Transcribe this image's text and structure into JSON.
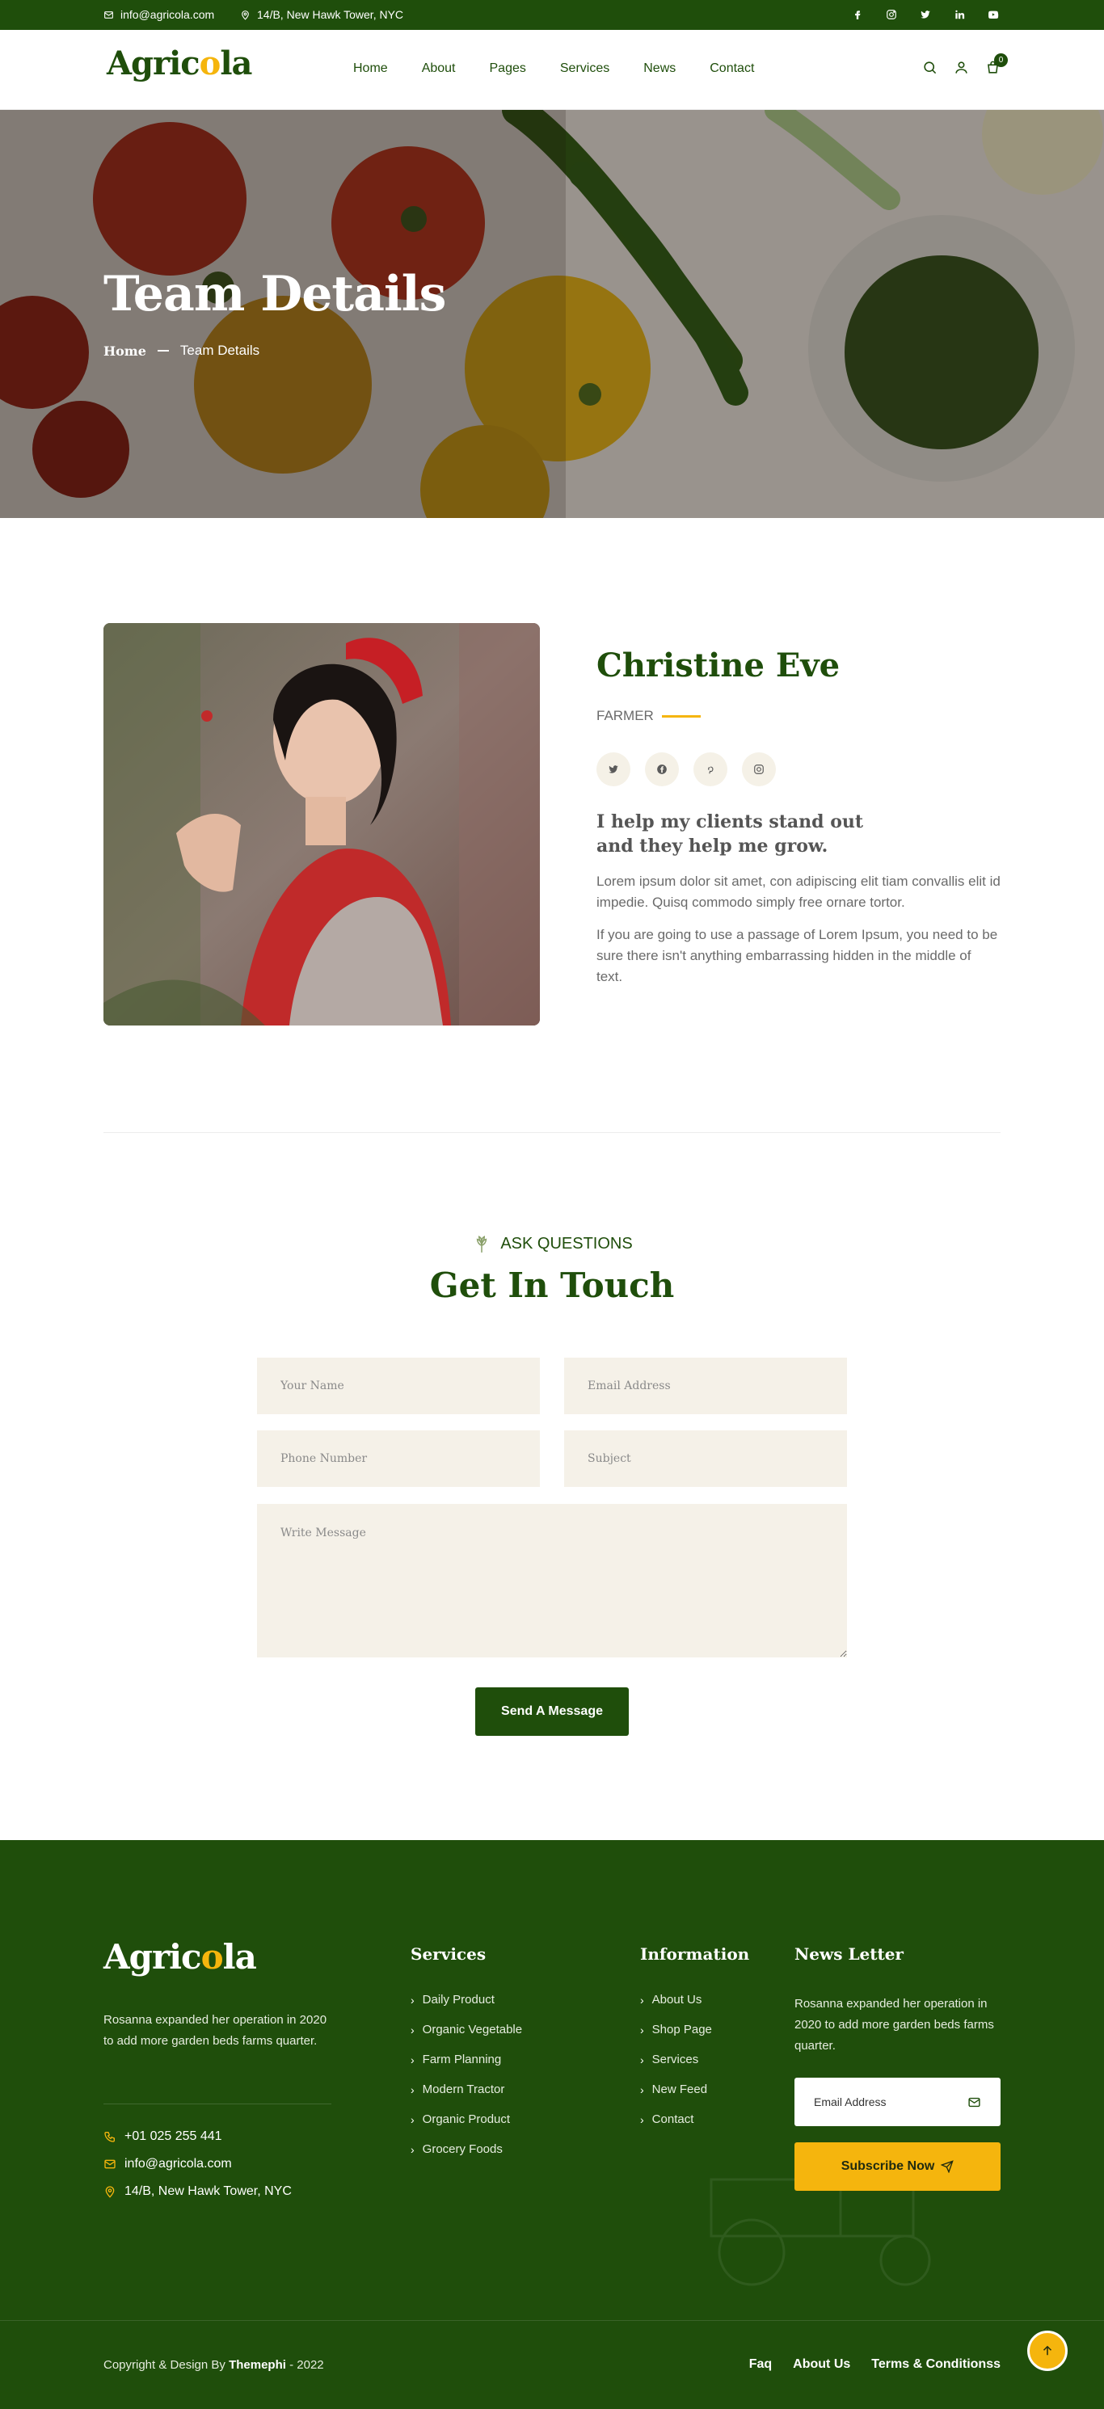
{
  "topbar": {
    "email": "info@agricola.com",
    "address": "14/B, New Hawk Tower, NYC",
    "socials": [
      "facebook-icon",
      "instagram-icon",
      "twitter-icon",
      "linkedin-icon",
      "youtube-icon"
    ]
  },
  "header": {
    "logo_part1": "Agric",
    "logo_o": "o",
    "logo_part2": "la",
    "nav": [
      "Home",
      "About",
      "Pages",
      "Services",
      "News",
      "Contact"
    ],
    "cart_count": "0"
  },
  "hero": {
    "title": "Team Details",
    "breadcrumb_home": "Home",
    "breadcrumb_current": "Team Details"
  },
  "member": {
    "name": "Christine Eve",
    "role": "FARMER",
    "heading": "I help my clients stand out and they help me grow.",
    "para1": "Lorem ipsum dolor sit amet, con adipiscing elit tiam convallis elit id impedie. Quisq commodo simply free ornare tortor.",
    "para2": "If you are going to use a passage of Lorem Ipsum, you need to be sure there isn't anything embarrassing hidden in the middle of text."
  },
  "contact": {
    "eyebrow": "ASK QUESTIONS",
    "title": "Get In Touch",
    "name_placeholder": "Your Name",
    "email_placeholder": "Email Address",
    "phone_placeholder": "Phone Number",
    "subject_placeholder": "Subject",
    "message_placeholder": "Write Message",
    "send_label": "Send A Message"
  },
  "footer": {
    "about": "Rosanna expanded her operation in 2020 to add more garden beds farms quarter.",
    "phone": "+01 025 255 441",
    "email": "info@agricola.com",
    "address": "14/B, New Hawk Tower, NYC",
    "services_title": "Services",
    "services": [
      "Daily Product",
      "Organic Vegetable",
      "Farm Planning",
      "Modern Tractor",
      "Organic Product",
      "Grocery Foods"
    ],
    "info_title": "Information",
    "info": [
      "About Us",
      "Shop Page",
      "Services",
      "New Feed",
      "Contact"
    ],
    "news_title": "News Letter",
    "news_text": "Rosanna expanded her operation in 2020 to add more garden beds farms quarter.",
    "news_placeholder": "Email Address",
    "subscribe_label": "Subscribe Now",
    "copyright_prefix": "Copyright & Design By",
    "copyright_brand": "Themephi",
    "copyright_suffix": "- 2022",
    "bottom_links": [
      "Faq",
      "About Us",
      "Terms & Conditionss"
    ]
  },
  "colors": {
    "primary_green": "#1f4e0b",
    "accent_yellow": "#f5b50d",
    "field_bg": "#f5f1e8"
  }
}
